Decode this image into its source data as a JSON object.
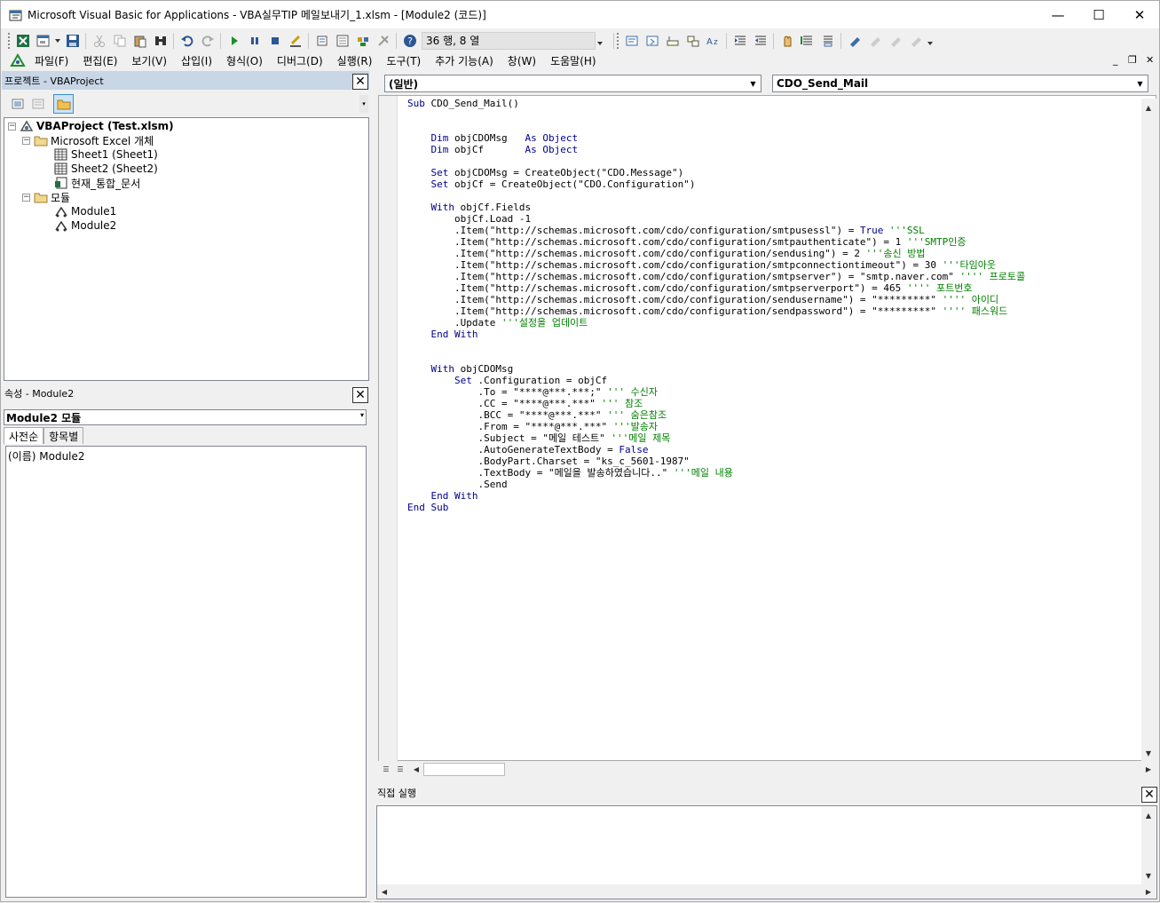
{
  "window": {
    "title": "Microsoft Visual Basic for Applications - VBA실무TIP 메일보내기_1.xlsm - [Module2 (코드)]",
    "minimize": "—",
    "maximize": "☐",
    "close": "✕"
  },
  "toolbar": {
    "position": "36 행, 8 열"
  },
  "menu": {
    "items": [
      "파일(F)",
      "편집(E)",
      "보기(V)",
      "삽입(I)",
      "형식(O)",
      "디버그(D)",
      "실행(R)",
      "도구(T)",
      "추가 기능(A)",
      "창(W)",
      "도움말(H)"
    ],
    "mdi_min": "_",
    "mdi_restore": "❐",
    "mdi_close": "✕"
  },
  "project": {
    "title": "프로젝트 - VBAProject",
    "root": "VBAProject (Test.xlsm)",
    "excel_objects": "Microsoft Excel 개체",
    "sheet1": "Sheet1 (Sheet1)",
    "sheet2": "Sheet2 (Sheet2)",
    "workbook": "현재_통합_문서",
    "modules": "모듈",
    "module1": "Module1",
    "module2": "Module2"
  },
  "properties": {
    "title": "속성 - Module2",
    "selector": "Module2 모듈",
    "tab_alpha": "사전순",
    "tab_category": "항목별",
    "name_row": "(이름) Module2"
  },
  "code": {
    "object_combo": "(일반)",
    "proc_combo": "CDO_Send_Mail",
    "lines": [
      [
        [
          "kw",
          "Sub"
        ],
        [
          "t",
          " CDO_Send_Mail()"
        ]
      ],
      [],
      [],
      [
        [
          "t",
          "    "
        ],
        [
          "kw",
          "Dim"
        ],
        [
          "t",
          " objCDOMsg   "
        ],
        [
          "kw",
          "As Object"
        ]
      ],
      [
        [
          "t",
          "    "
        ],
        [
          "kw",
          "Dim"
        ],
        [
          "t",
          " objCf       "
        ],
        [
          "kw",
          "As Object"
        ]
      ],
      [],
      [
        [
          "t",
          "    "
        ],
        [
          "kw",
          "Set"
        ],
        [
          "t",
          " objCDOMsg = CreateObject(\"CDO.Message\")"
        ]
      ],
      [
        [
          "t",
          "    "
        ],
        [
          "kw",
          "Set"
        ],
        [
          "t",
          " objCf = CreateObject(\"CDO.Configuration\")"
        ]
      ],
      [],
      [
        [
          "t",
          "    "
        ],
        [
          "kw",
          "With"
        ],
        [
          "t",
          " objCf.Fields"
        ]
      ],
      [
        [
          "t",
          "        objCf.Load -1"
        ]
      ],
      [
        [
          "t",
          "        .Item(\"http://schemas.microsoft.com/cdo/configuration/smtpusessl\") = "
        ],
        [
          "kw",
          "True"
        ],
        [
          "cm",
          " '''SSL"
        ]
      ],
      [
        [
          "t",
          "        .Item(\"http://schemas.microsoft.com/cdo/configuration/smtpauthenticate\") = 1 "
        ],
        [
          "cm",
          "'''SMTP인증"
        ]
      ],
      [
        [
          "t",
          "        .Item(\"http://schemas.microsoft.com/cdo/configuration/sendusing\") = 2 "
        ],
        [
          "cm",
          "'''송신 방법"
        ]
      ],
      [
        [
          "t",
          "        .Item(\"http://schemas.microsoft.com/cdo/configuration/smtpconnectiontimeout\") = 30 "
        ],
        [
          "cm",
          "'''타임아웃"
        ]
      ],
      [
        [
          "t",
          "        .Item(\"http://schemas.microsoft.com/cdo/configuration/smtpserver\") = \"smtp.naver.com\" "
        ],
        [
          "cm",
          "'''' 프로토콜"
        ]
      ],
      [
        [
          "t",
          "        .Item(\"http://schemas.microsoft.com/cdo/configuration/smtpserverport\") = 465 "
        ],
        [
          "cm",
          "'''' 포트번호"
        ]
      ],
      [
        [
          "t",
          "        .Item(\"http://schemas.microsoft.com/cdo/configuration/sendusername\") = \"*********\" "
        ],
        [
          "cm",
          "'''' 아이디"
        ]
      ],
      [
        [
          "t",
          "        .Item(\"http://schemas.microsoft.com/cdo/configuration/sendpassword\") = \"*********\" "
        ],
        [
          "cm",
          "'''' 패스워드"
        ]
      ],
      [
        [
          "t",
          "        .Update "
        ],
        [
          "cm",
          "'''설정을 업데이트"
        ]
      ],
      [
        [
          "t",
          "    "
        ],
        [
          "kw",
          "End With"
        ]
      ],
      [],
      [],
      [
        [
          "t",
          "    "
        ],
        [
          "kw",
          "With"
        ],
        [
          "t",
          " objCDOMsg"
        ]
      ],
      [
        [
          "t",
          "        "
        ],
        [
          "kw",
          "Set"
        ],
        [
          "t",
          " .Configuration = objCf"
        ]
      ],
      [
        [
          "t",
          "            .To = \"****@***.***;\" "
        ],
        [
          "cm",
          "''' 수신자"
        ]
      ],
      [
        [
          "t",
          "            .CC = \"****@***.***\" "
        ],
        [
          "cm",
          "''' 참조"
        ]
      ],
      [
        [
          "t",
          "            .BCC = \"****@***.***\" "
        ],
        [
          "cm",
          "''' 숨은참조"
        ]
      ],
      [
        [
          "t",
          "            .From = \"****@***.***\" "
        ],
        [
          "cm",
          "'''발송자"
        ]
      ],
      [
        [
          "t",
          "            .Subject = \"메일 테스트\" "
        ],
        [
          "cm",
          "'''메일 제목"
        ]
      ],
      [
        [
          "t",
          "            .AutoGenerateTextBody = "
        ],
        [
          "kw",
          "False"
        ]
      ],
      [
        [
          "t",
          "            .BodyPart.Charset = \"ks_c_5601-1987\""
        ]
      ],
      [
        [
          "t",
          "            .TextBody = \"메일을 발송하였습니다..\" "
        ],
        [
          "cm",
          "'''메일 내용"
        ]
      ],
      [
        [
          "t",
          "            .Send"
        ]
      ],
      [
        [
          "t",
          "    "
        ],
        [
          "kw",
          "End With"
        ]
      ],
      [
        [
          "kw",
          "End Sub"
        ]
      ]
    ]
  },
  "immediate": {
    "title": "직접 실행"
  },
  "colors": {
    "keyword": "#00008b",
    "comment": "#008000",
    "panel_title_bg": "#c8d6e6"
  }
}
